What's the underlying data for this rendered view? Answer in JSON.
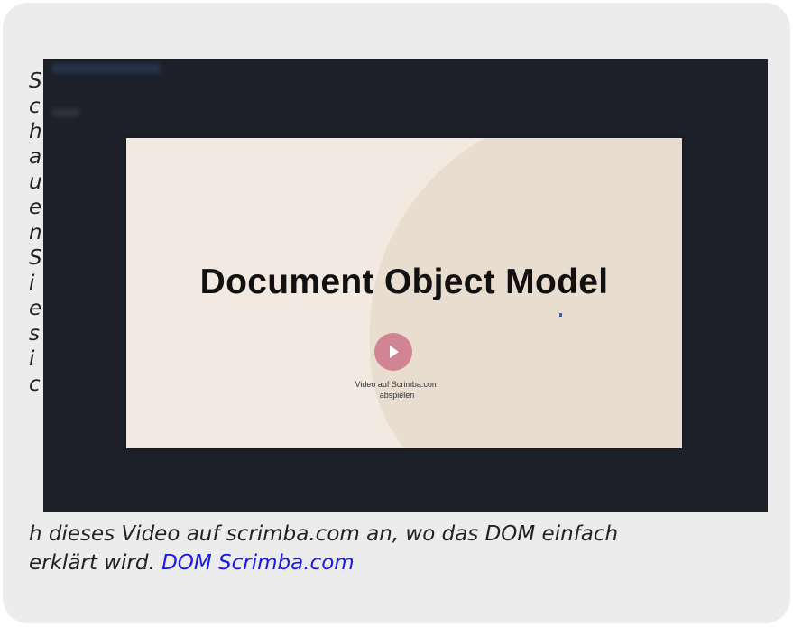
{
  "caption": {
    "first_word_letters": [
      "S",
      "c",
      "h",
      "a",
      "u",
      "e",
      "n",
      "S",
      "i",
      "e",
      "s",
      "i",
      "c"
    ],
    "line1": "h dieses Video auf scrimba.com an, wo das DOM einfach",
    "line2": "erklärt wird.",
    "link_text": "DOM Scrimba.com"
  },
  "video": {
    "slide_title": "Document Object Model",
    "play_label_line1": "Video auf Scrimba.com",
    "play_label_line2": "abspielen",
    "play_icon": "play-icon",
    "colors": {
      "frame_bg": "#1d2028",
      "slide_bg": "#f2e9e0",
      "play_button": "#d08494",
      "link": "#1a1ae6"
    }
  }
}
